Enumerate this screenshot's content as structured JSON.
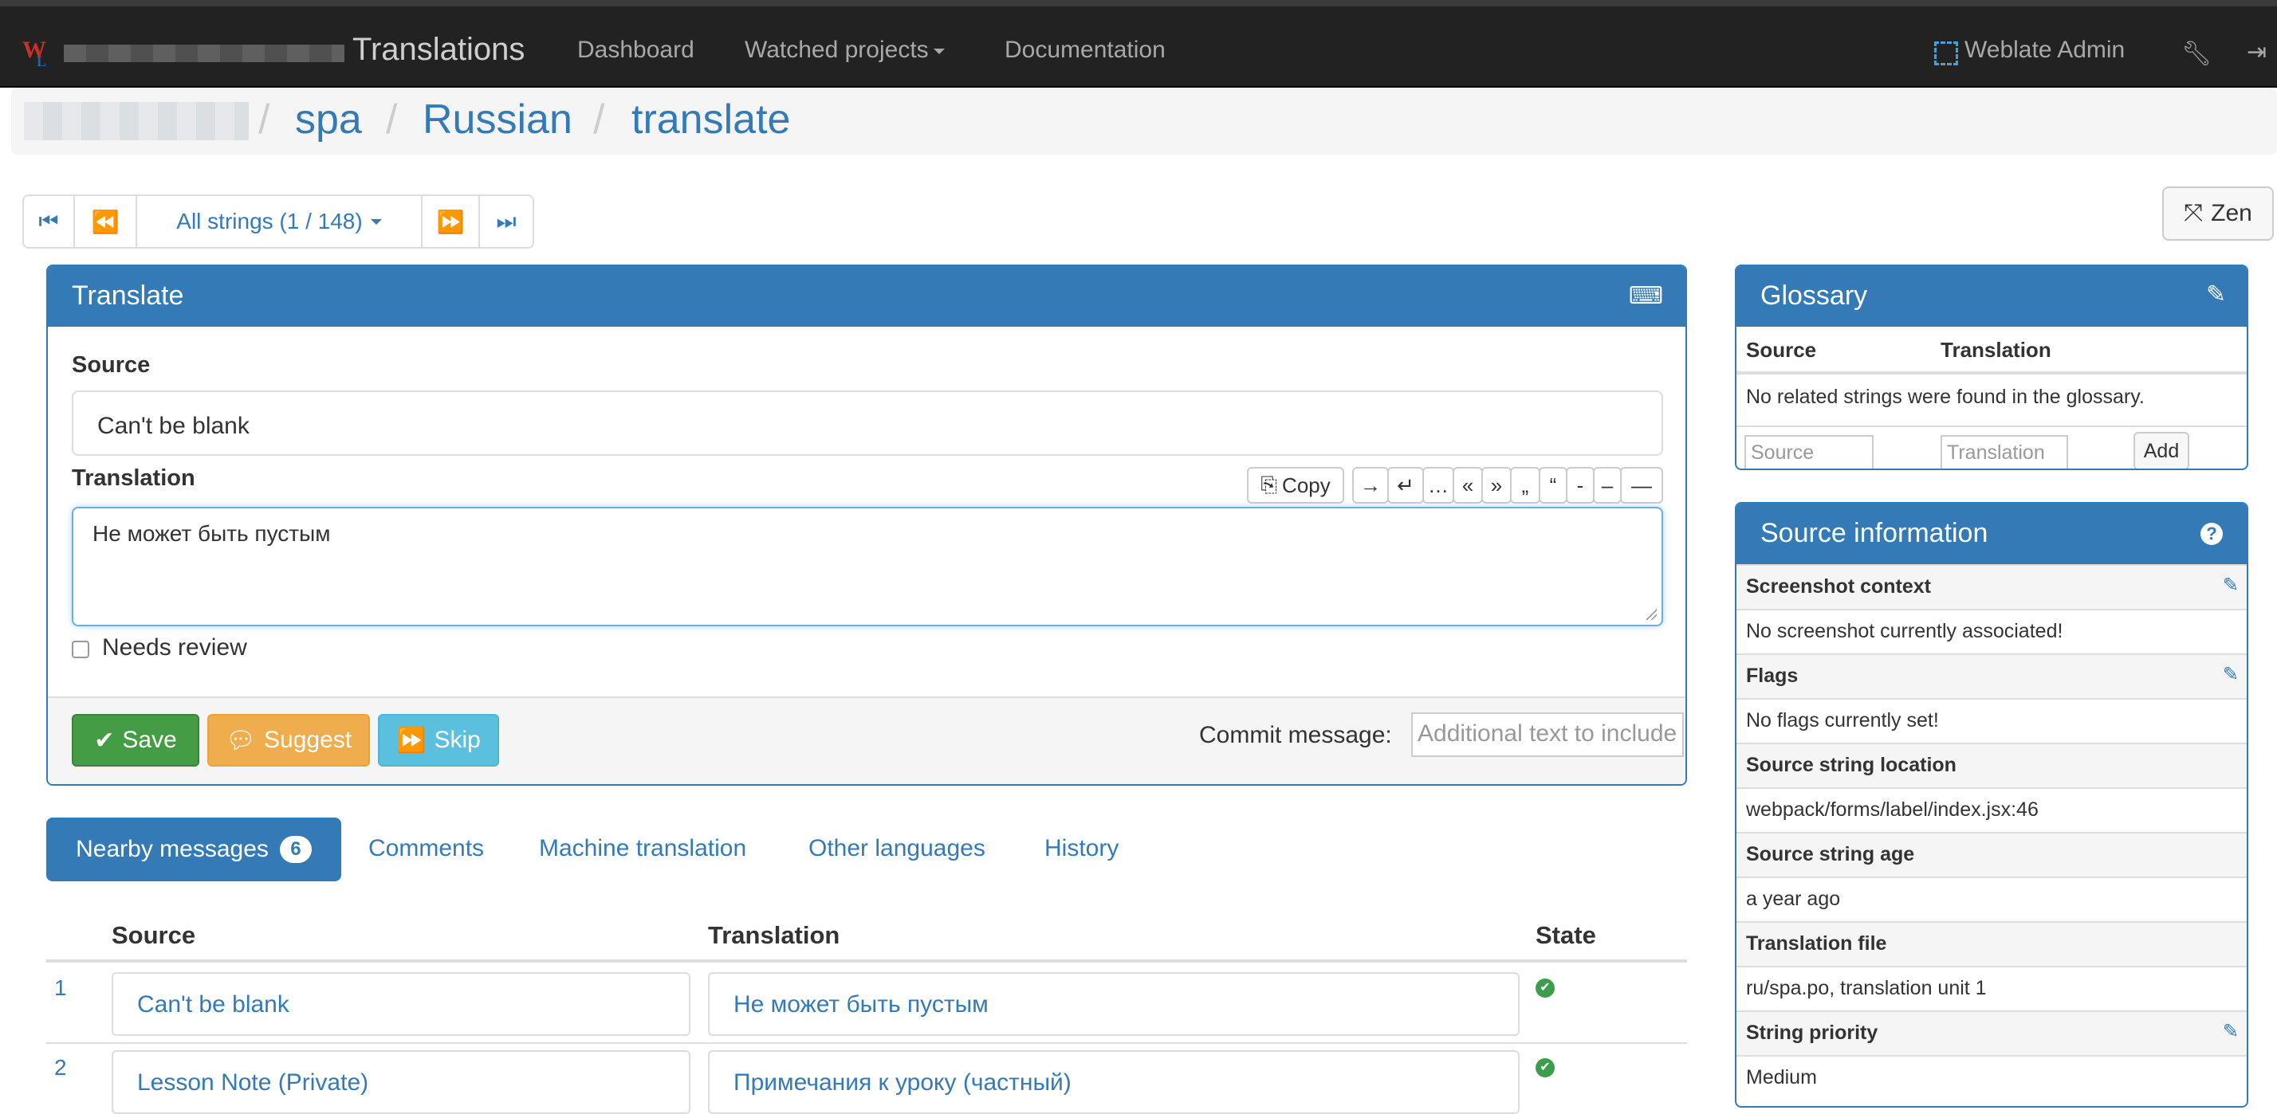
{
  "navbar": {
    "title": "Translations",
    "links": [
      "Dashboard",
      "Watched projects",
      "Documentation"
    ],
    "user": "Weblate Admin",
    "icons": [
      "weblate-logo-icon",
      "user-icon",
      "wrench-icon",
      "logout-icon"
    ]
  },
  "breadcrumb": {
    "items": [
      "spa",
      "Russian",
      "translate"
    ],
    "separator": "/"
  },
  "pager": {
    "label": "All strings (1 / 148)",
    "first": "⏮",
    "prev": "⏪",
    "next": "⏩",
    "last": "⏭"
  },
  "zen": {
    "icon": "⤧",
    "label": "Zen"
  },
  "translate": {
    "title": "Translate",
    "keyboard_icon": "⌨",
    "source_label": "Source",
    "source_text": "Can't be blank",
    "translation_label": "Translation",
    "copy_label": "Copy",
    "special_chars": [
      "→",
      "↵",
      "…",
      "«",
      "»",
      "„",
      "“",
      "-",
      "–",
      "—"
    ],
    "translation_value": "Не может быть пустым",
    "needs_review": "Needs review",
    "save": "Save",
    "suggest": "Suggest",
    "skip": "Skip",
    "commit_label": "Commit message:",
    "commit_placeholder": "Additional text to include",
    "accent_colors": {
      "primary": "#337ab7",
      "save": "#449d44",
      "suggest": "#f0ad4e",
      "skip": "#5bc0de"
    }
  },
  "tabs": {
    "nearby": "Nearby messages",
    "nearby_count": "6",
    "others": [
      "Comments",
      "Machine translation",
      "Other languages",
      "History"
    ]
  },
  "nearby": {
    "headers": [
      "Source",
      "Translation",
      "State"
    ],
    "rows": [
      {
        "num": "1",
        "source": "Can't be blank",
        "translation": "Не может быть пустым",
        "state": "✔"
      },
      {
        "num": "2",
        "source": "Lesson Note (Private)",
        "translation": "Примечания к уроку (частный)",
        "state": "✔"
      }
    ]
  },
  "glossary": {
    "title": "Glossary",
    "edit_icon": "✎",
    "col_source": "Source",
    "col_translation": "Translation",
    "empty": "No related strings were found in the glossary.",
    "source_placeholder": "Source",
    "translation_placeholder": "Translation",
    "add": "Add"
  },
  "source_info": {
    "title": "Source information",
    "help_icon": "?",
    "rows": [
      {
        "label": "Screenshot context",
        "value": "No screenshot currently associated!"
      },
      {
        "label": "Flags",
        "value": "No flags currently set!"
      },
      {
        "label": "Source string location",
        "value": "webpack/forms/label/index.jsx:46"
      },
      {
        "label": "Source string age",
        "value": "a year ago"
      },
      {
        "label": "Translation file",
        "value": "ru/spa.po, translation unit 1"
      },
      {
        "label": "String priority",
        "value": "Medium"
      }
    ]
  }
}
